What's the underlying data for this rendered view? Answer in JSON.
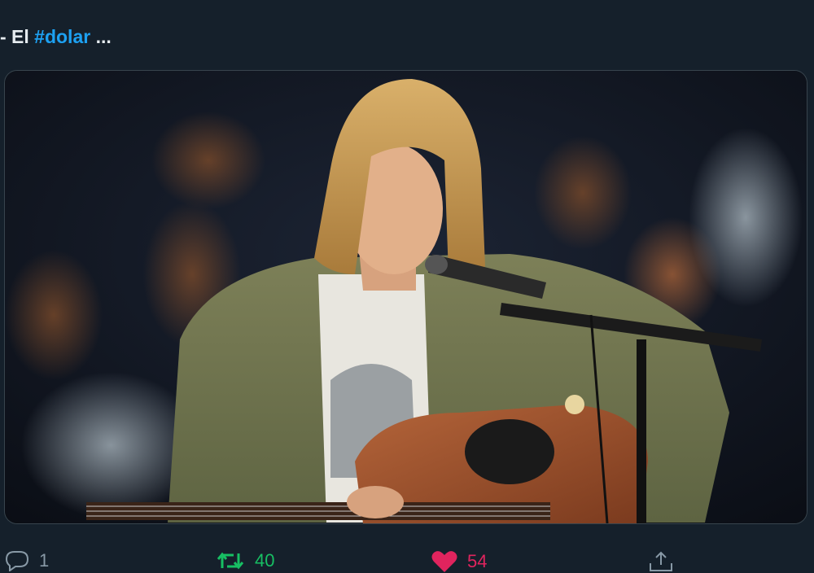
{
  "tweet": {
    "text_prefix": "- El ",
    "hashtag": "#dolar",
    "text_suffix": " ..."
  },
  "media": {
    "alt": "Musician with blonde hair in a green cardigan playing an acoustic guitar at a microphone"
  },
  "actions": {
    "reply_count": "1",
    "retweet_count": "40",
    "like_count": "54"
  },
  "colors": {
    "background": "#15202b",
    "hashtag": "#1da1f2",
    "retweet": "#17bf63",
    "like": "#e0245e",
    "muted": "#8899a6"
  },
  "icons": [
    "reply-icon",
    "retweet-icon",
    "like-icon",
    "share-icon"
  ]
}
